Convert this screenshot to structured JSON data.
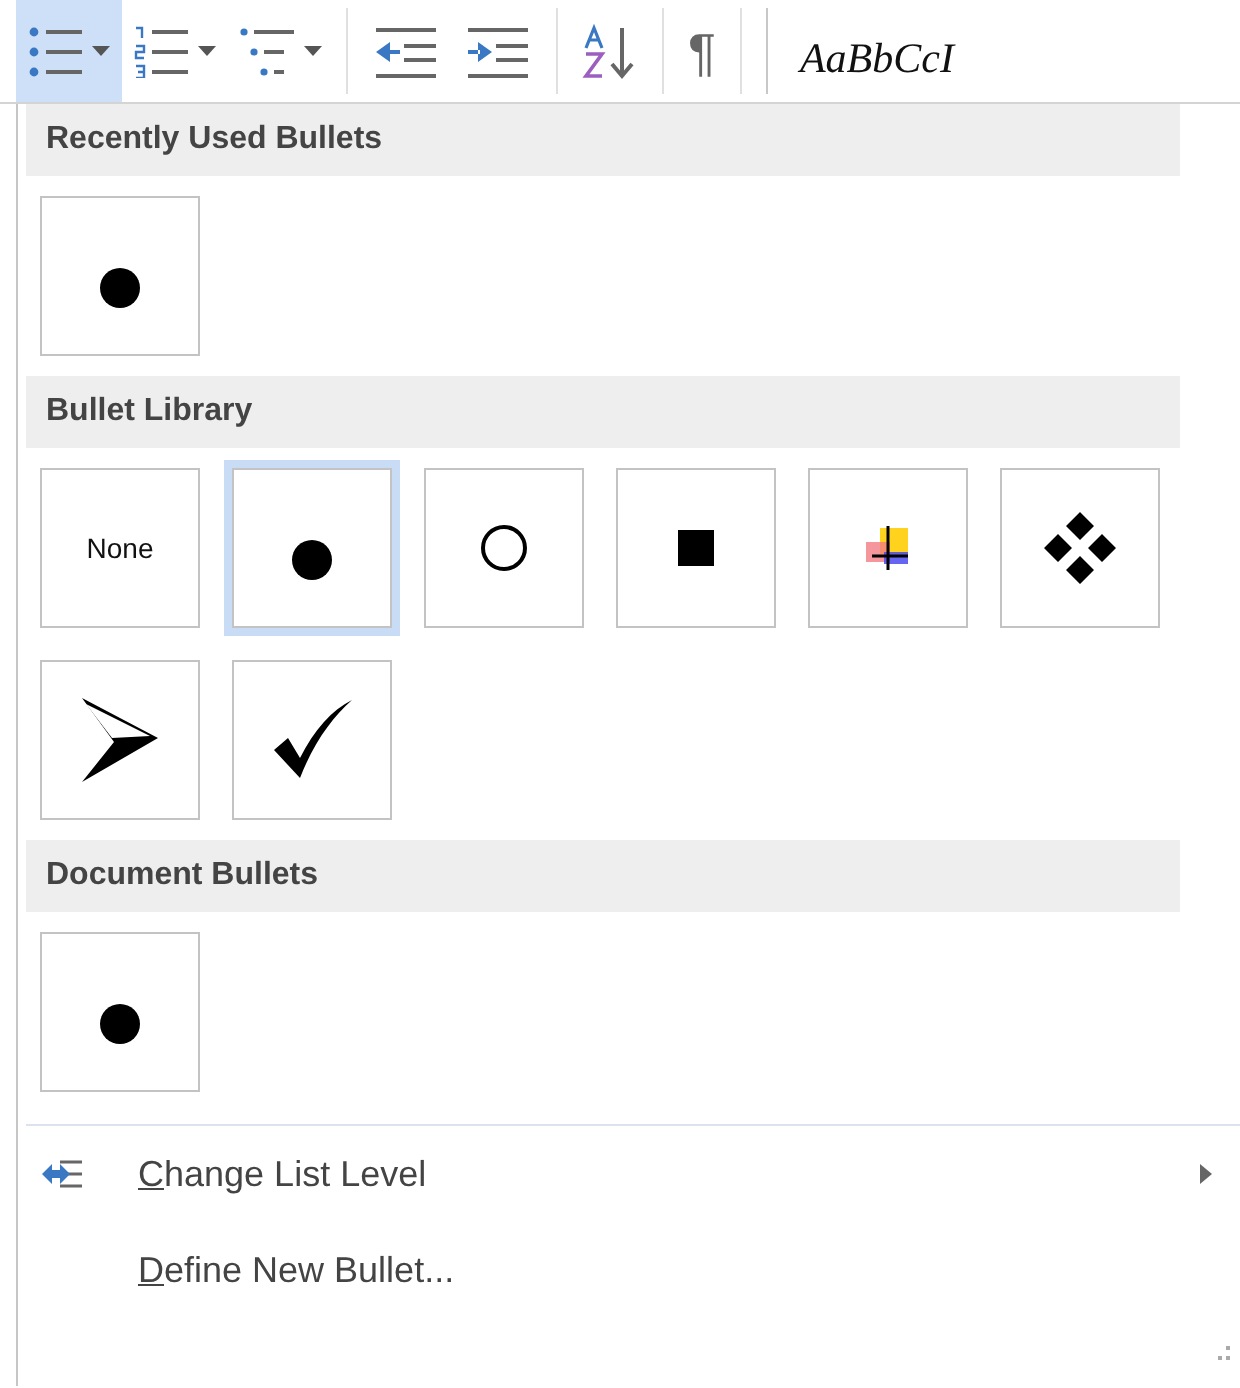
{
  "toolbar": {
    "items": [
      {
        "kind": "bullets",
        "selected": true,
        "dropdown": true
      },
      {
        "kind": "numbering",
        "selected": false,
        "dropdown": true
      },
      {
        "kind": "multilevel",
        "selected": false,
        "dropdown": true
      },
      {
        "kind": "separator"
      },
      {
        "kind": "outdent",
        "selected": false
      },
      {
        "kind": "indent",
        "selected": false
      },
      {
        "kind": "separator"
      },
      {
        "kind": "sort",
        "selected": false
      },
      {
        "kind": "separator"
      },
      {
        "kind": "pilcrow",
        "selected": false,
        "label": "¶"
      },
      {
        "kind": "separator"
      },
      {
        "kind": "separator"
      },
      {
        "kind": "style",
        "label": "AaBbCcI"
      }
    ]
  },
  "menu": {
    "sections": [
      {
        "title": "Recently Used Bullets",
        "bullets": [
          {
            "kind": "disc",
            "selected": false
          }
        ]
      },
      {
        "title": "Bullet Library",
        "bullets": [
          {
            "kind": "none",
            "label": "None",
            "selected": false
          },
          {
            "kind": "disc",
            "selected": true
          },
          {
            "kind": "circle",
            "selected": false
          },
          {
            "kind": "square",
            "selected": false
          },
          {
            "kind": "picture",
            "selected": false
          },
          {
            "kind": "diamonds",
            "selected": false
          },
          {
            "kind": "arrowhead",
            "selected": false
          },
          {
            "kind": "check",
            "selected": false
          }
        ]
      },
      {
        "title": "Document Bullets",
        "bullets": [
          {
            "kind": "disc",
            "selected": false
          }
        ]
      }
    ],
    "commands": [
      {
        "label": "Change List Level",
        "underline_first": true,
        "icon": true,
        "submenu": true
      },
      {
        "label": "Define New Bullet...",
        "underline_first": true,
        "icon": false,
        "submenu": false
      }
    ]
  }
}
